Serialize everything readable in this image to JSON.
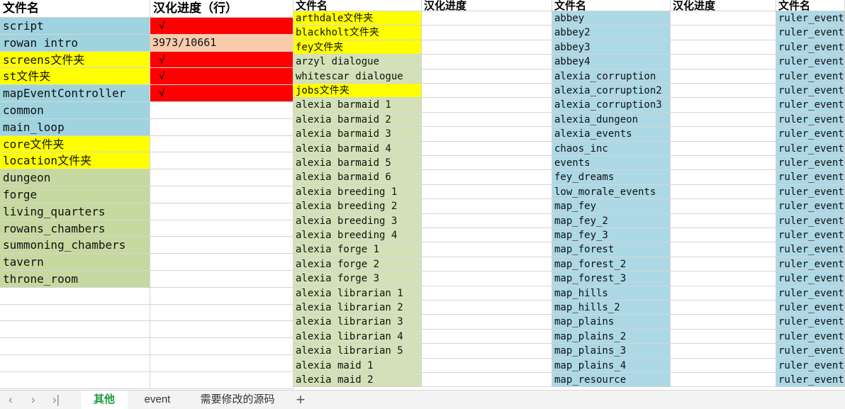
{
  "colors": {
    "blue": "#9fd3e0",
    "lightblue": "#add8e6",
    "yellow": "#ffff00",
    "red": "#ff0000",
    "peach": "#f8cbad",
    "green": "#c6d9a0",
    "lightgreen": "#d3e1b8",
    "accent": "#1a9c3a"
  },
  "left_sheet": {
    "headers": [
      "文件名",
      "汉化进度（行）"
    ],
    "rows": [
      {
        "name": "script",
        "progress": "√",
        "c1": "blue",
        "c2": "red"
      },
      {
        "name": "rowan intro",
        "progress": "3973/10661",
        "c1": "blue",
        "c2": "peach"
      },
      {
        "name": "screens文件夹",
        "progress": "√",
        "c1": "yellow",
        "c2": "red"
      },
      {
        "name": "st文件夹",
        "progress": "√",
        "c1": "yellow",
        "c2": "red"
      },
      {
        "name": "mapEventController",
        "progress": "√",
        "c1": "blue",
        "c2": "red"
      },
      {
        "name": "common",
        "progress": "",
        "c1": "blue",
        "c2": ""
      },
      {
        "name": "main_loop",
        "progress": "",
        "c1": "blue",
        "c2": ""
      },
      {
        "name": "core文件夹",
        "progress": "",
        "c1": "yellow",
        "c2": ""
      },
      {
        "name": "location文件夹",
        "progress": "",
        "c1": "yellow",
        "c2": ""
      },
      {
        "name": "dungeon",
        "progress": "",
        "c1": "green",
        "c2": ""
      },
      {
        "name": "forge",
        "progress": "",
        "c1": "green",
        "c2": ""
      },
      {
        "name": "living_quarters",
        "progress": "",
        "c1": "green",
        "c2": ""
      },
      {
        "name": "rowans_chambers",
        "progress": "",
        "c1": "green",
        "c2": ""
      },
      {
        "name": "summoning_chambers",
        "progress": "",
        "c1": "green",
        "c2": ""
      },
      {
        "name": "tavern",
        "progress": "",
        "c1": "green",
        "c2": ""
      },
      {
        "name": "throne_room",
        "progress": "",
        "c1": "green",
        "c2": ""
      }
    ]
  },
  "mid_sheet": {
    "headers": [
      "文件名",
      "汉化进度"
    ],
    "rows": [
      {
        "name": "arthdale文件夹",
        "c": "yellow"
      },
      {
        "name": "blackholt文件夹",
        "c": "yellow"
      },
      {
        "name": "fey文件夹",
        "c": "yellow"
      },
      {
        "name": "arzyl dialogue",
        "c": "lightgreen"
      },
      {
        "name": "whitescar dialogue",
        "c": "lightgreen"
      },
      {
        "name": "jobs文件夹",
        "c": "yellow"
      },
      {
        "name": "alexia barmaid 1",
        "c": "lightgreen"
      },
      {
        "name": "alexia barmaid 2",
        "c": "lightgreen"
      },
      {
        "name": "alexia barmaid 3",
        "c": "lightgreen"
      },
      {
        "name": "alexia barmaid 4",
        "c": "lightgreen"
      },
      {
        "name": "alexia barmaid 5",
        "c": "lightgreen"
      },
      {
        "name": "alexia barmaid 6",
        "c": "lightgreen"
      },
      {
        "name": "alexia breeding 1",
        "c": "lightgreen"
      },
      {
        "name": "alexia breeding 2",
        "c": "lightgreen"
      },
      {
        "name": "alexia breeding 3",
        "c": "lightgreen"
      },
      {
        "name": "alexia breeding 4",
        "c": "lightgreen"
      },
      {
        "name": "alexia forge 1",
        "c": "lightgreen"
      },
      {
        "name": "alexia forge 2",
        "c": "lightgreen"
      },
      {
        "name": "alexia forge 3",
        "c": "lightgreen"
      },
      {
        "name": "alexia librarian 1",
        "c": "lightgreen"
      },
      {
        "name": "alexia librarian 2",
        "c": "lightgreen"
      },
      {
        "name": "alexia librarian 3",
        "c": "lightgreen"
      },
      {
        "name": "alexia librarian 4",
        "c": "lightgreen"
      },
      {
        "name": "alexia librarian 5",
        "c": "lightgreen"
      },
      {
        "name": "alexia maid 1",
        "c": "lightgreen"
      },
      {
        "name": "alexia maid 2",
        "c": "lightgreen"
      }
    ]
  },
  "right_sheet": {
    "headers": [
      "文件名",
      "汉化进度",
      "文件名"
    ],
    "names": [
      "abbey",
      "abbey2",
      "abbey3",
      "abbey4",
      "alexia_corruption",
      "alexia_corruption2",
      "alexia_corruption3",
      "alexia_dungeon",
      "alexia_events",
      "chaos_inc",
      "events",
      "fey_dreams",
      "low_morale_events",
      "map_fey",
      "map_fey_2",
      "map_fey_3",
      "map_forest",
      "map_forest_2",
      "map_forest_3",
      "map_hills",
      "map_hills_2",
      "map_plains",
      "map_plains_2",
      "map_plains_3",
      "map_plains_4",
      "map_resource"
    ],
    "ruler_label": "ruler_event"
  },
  "tabs": [
    "其他",
    "event",
    "需要修改的源码"
  ],
  "active_tab": 0,
  "add_tab": "+",
  "nav": {
    "prev": "‹",
    "next": "›",
    "last": "›|"
  }
}
